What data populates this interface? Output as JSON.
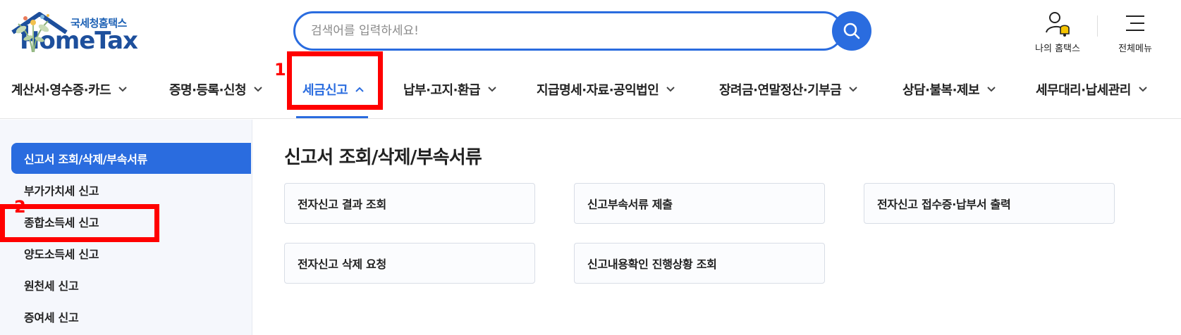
{
  "header": {
    "logo_sub": "국세청홈택스",
    "logo_main": "HomeTax",
    "search_placeholder": "검색어를 입력하세요!",
    "util_my_label": "나의 홈택스",
    "util_menu_label": "전체메뉴",
    "icons": {
      "search": "search-icon",
      "my_hometax": "user-bell-icon",
      "full_menu": "hamburger-menu-icon"
    }
  },
  "nav": {
    "items": [
      {
        "label": "계산서·영수증·카드",
        "expanded": false
      },
      {
        "label": "증명·등록·신청",
        "expanded": false
      },
      {
        "label": "세금신고",
        "expanded": true
      },
      {
        "label": "납부·고지·환급",
        "expanded": false
      },
      {
        "label": "지급명세·자료·공익법인",
        "expanded": false
      },
      {
        "label": "장려금·연말정산·기부금",
        "expanded": false
      },
      {
        "label": "상담·불복·제보",
        "expanded": false
      },
      {
        "label": "세무대리·납세관리",
        "expanded": false
      }
    ]
  },
  "annotations": {
    "label_1": "1",
    "label_2": "2",
    "color": "#ff0000"
  },
  "sidebar": {
    "items": [
      {
        "label": "신고서 조회/삭제/부속서류",
        "active": true
      },
      {
        "label": "부가가치세 신고",
        "active": false
      },
      {
        "label": "종합소득세 신고",
        "active": false
      },
      {
        "label": "양도소득세 신고",
        "active": false
      },
      {
        "label": "원천세 신고",
        "active": false
      },
      {
        "label": "증여세 신고",
        "active": false
      }
    ]
  },
  "main": {
    "title": "신고서 조회/삭제/부속서류",
    "cards": [
      {
        "label": "전자신고 결과 조회"
      },
      {
        "label": "신고부속서류 제출"
      },
      {
        "label": "전자신고 접수증·납부서 출력"
      },
      {
        "label": "전자신고 삭제 요청"
      },
      {
        "label": "신고내용확인 진행상황 조회"
      }
    ]
  },
  "colors": {
    "accent": "#2a6cdf",
    "brand_dark": "#1d4f9c",
    "sidebar_bg": "#f5f7fc",
    "annotation": "#ff0000"
  }
}
